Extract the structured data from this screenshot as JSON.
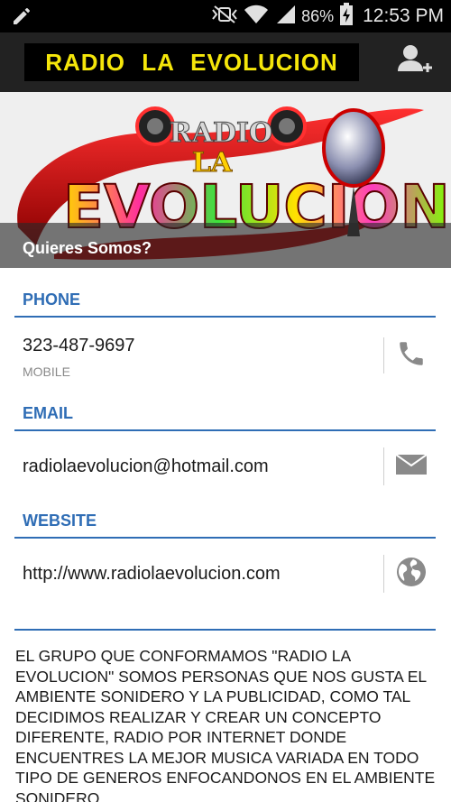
{
  "status_bar": {
    "battery": "86%",
    "time": "12:53 PM",
    "icons": [
      "edit-icon",
      "mute-icon",
      "wifi-icon",
      "signal-icon",
      "battery-charging-icon"
    ]
  },
  "action_bar": {
    "title": "RADIO LA EVOLUCION",
    "title_color": "#f5e60a",
    "add_contact_icon": "add-contact-icon"
  },
  "header": {
    "logo_word_top": "RADIO",
    "logo_word_mid": "LA",
    "logo_word_main": "EVOLUCION",
    "caption": "Quieres Somos?"
  },
  "sections": {
    "phone": {
      "heading": "PHONE",
      "value": "323-487-9697",
      "type": "MOBILE",
      "action_icon": "phone-icon"
    },
    "email": {
      "heading": "EMAIL",
      "value": "radiolaevolucion@hotmail.com",
      "action_icon": "email-icon"
    },
    "website": {
      "heading": "WEBSITE",
      "value": "http://www.radiolaevolucion.com",
      "action_icon": "globe-icon"
    }
  },
  "about": {
    "text": "EL GRUPO QUE CONFORMAMOS \"RADIO LA EVOLUCION\" SOMOS PERSONAS QUE NOS GUSTA EL AMBIENTE SONIDERO Y LA PUBLICIDAD, COMO TAL DECIDIMOS REALIZAR Y CREAR UN CONCEPTO DIFERENTE, RADIO POR INTERNET DONDE ENCUENTRES LA MEJOR MUSICA VARIADA EN TODO TIPO DE GENEROS ENFOCANDONOS EN EL AMBIENTE SONIDERO"
  },
  "colors": {
    "accent": "#2f6db5",
    "action_bar": "#222222",
    "status_bar": "#000000"
  }
}
